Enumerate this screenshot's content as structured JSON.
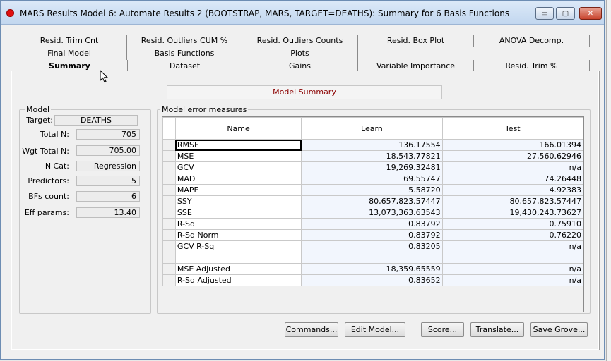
{
  "window": {
    "title": "MARS Results Model 6: Automate Results 2 (BOOTSTRAP, MARS, TARGET=DEATHS): Summary for 6 Basis Functions",
    "controls": {
      "minimize": "▭",
      "maximize": "▢",
      "close": "✕"
    }
  },
  "tabs": {
    "row1": [
      "Resid. Trim Cnt",
      "Resid. Outliers CUM %",
      "Resid. Outliers Counts",
      "Resid. Box Plot",
      "ANOVA Decomp."
    ],
    "row2": [
      "Final Model",
      "Basis Functions",
      "Plots"
    ],
    "row3": [
      "Summary",
      "Dataset",
      "Gains",
      "Variable Importance",
      "Resid. Trim %"
    ],
    "active": "Summary"
  },
  "model_summary_header": "Model Summary",
  "model": {
    "group_label": "Model",
    "target_label": "Target:",
    "target_value": "DEATHS",
    "fields": [
      {
        "label": "Total N:",
        "value": "705"
      },
      {
        "label": "Wgt Total N:",
        "value": "705.00"
      },
      {
        "label": "N Cat:",
        "value": "Regression"
      },
      {
        "label": "Predictors:",
        "value": "5"
      },
      {
        "label": "BFs count:",
        "value": "6"
      },
      {
        "label": "Eff params:",
        "value": "13.40"
      }
    ]
  },
  "errors": {
    "group_label": "Model error measures",
    "columns": [
      "Name",
      "Learn",
      "Test"
    ],
    "rows": [
      {
        "name": "RMSE",
        "learn": "136.17554",
        "test": "166.01394"
      },
      {
        "name": "MSE",
        "learn": "18,543.77821",
        "test": "27,560.62946"
      },
      {
        "name": "GCV",
        "learn": "19,269.32481",
        "test": "n/a"
      },
      {
        "name": "MAD",
        "learn": "69.55747",
        "test": "74.26448"
      },
      {
        "name": "MAPE",
        "learn": "5.58720",
        "test": "4.92383"
      },
      {
        "name": "SSY",
        "learn": "80,657,823.57447",
        "test": "80,657,823.57447"
      },
      {
        "name": "SSE",
        "learn": "13,073,363.63543",
        "test": "19,430,243.73627"
      },
      {
        "name": "R-Sq",
        "learn": "0.83792",
        "test": "0.75910"
      },
      {
        "name": "R-Sq Norm",
        "learn": "0.83792",
        "test": "0.76220"
      },
      {
        "name": "GCV R-Sq",
        "learn": "0.83205",
        "test": "n/a"
      },
      {
        "name": "",
        "learn": "",
        "test": ""
      },
      {
        "name": "MSE Adjusted",
        "learn": "18,359.65559",
        "test": "n/a"
      },
      {
        "name": "R-Sq Adjusted",
        "learn": "0.83652",
        "test": "n/a"
      }
    ]
  },
  "buttons": {
    "commands": "Commands...",
    "edit_model": "Edit Model...",
    "score": "Score...",
    "translate": "Translate...",
    "save_grove": "Save Grove..."
  }
}
